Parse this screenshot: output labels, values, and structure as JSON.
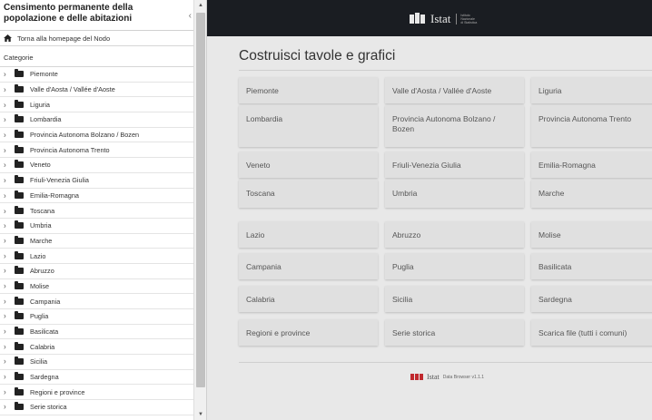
{
  "sidebar": {
    "title": "Censimento permanente della popolazione e delle abitazioni",
    "collapse_glyph": "‹",
    "home_label": "Torna alla homepage del Nodo",
    "categories_label": "Categorie",
    "items": [
      "Piemonte",
      "Valle d'Aosta / Vallée d'Aoste",
      "Liguria",
      "Lombardia",
      "Provincia Autonoma Bolzano / Bozen",
      "Provincia Autonoma Trento",
      "Veneto",
      "Friuli-Venezia Giulia",
      "Emilia-Romagna",
      "Toscana",
      "Umbria",
      "Marche",
      "Lazio",
      "Abruzzo",
      "Molise",
      "Campania",
      "Puglia",
      "Basilicata",
      "Calabria",
      "Sicilia",
      "Sardegna",
      "Regioni e province",
      "Serie storica"
    ]
  },
  "header": {
    "logo_text": "Istat",
    "logo_sub": "Istituto Nazionale di Statistica"
  },
  "main": {
    "title": "Costruisci tavole e grafici",
    "cards": [
      "Piemonte",
      "Valle d'Aosta / Vallée d'Aoste",
      "Liguria",
      "Lombardia",
      "Provincia Autonoma Bolzano / Bozen",
      "Provincia Autonoma Trento",
      "Veneto",
      "Friuli-Venezia Giulia",
      "Emilia-Romagna",
      "Toscana",
      "Umbria",
      "Marche",
      "Lazio",
      "Abruzzo",
      "Molise",
      "Campania",
      "Puglia",
      "Basilicata",
      "Calabria",
      "Sicilia",
      "Sardegna",
      "Regioni e province",
      "Serie storica",
      "Scarica file (tutti i comuni)"
    ]
  },
  "footer": {
    "istat": "Istat",
    "version": "Data Browser v1.1.1"
  },
  "colors": {
    "topbar": "#1a1d22",
    "card": "#e0e0e0",
    "background": "#e8e8e8",
    "logo_red": "#c0282d"
  }
}
